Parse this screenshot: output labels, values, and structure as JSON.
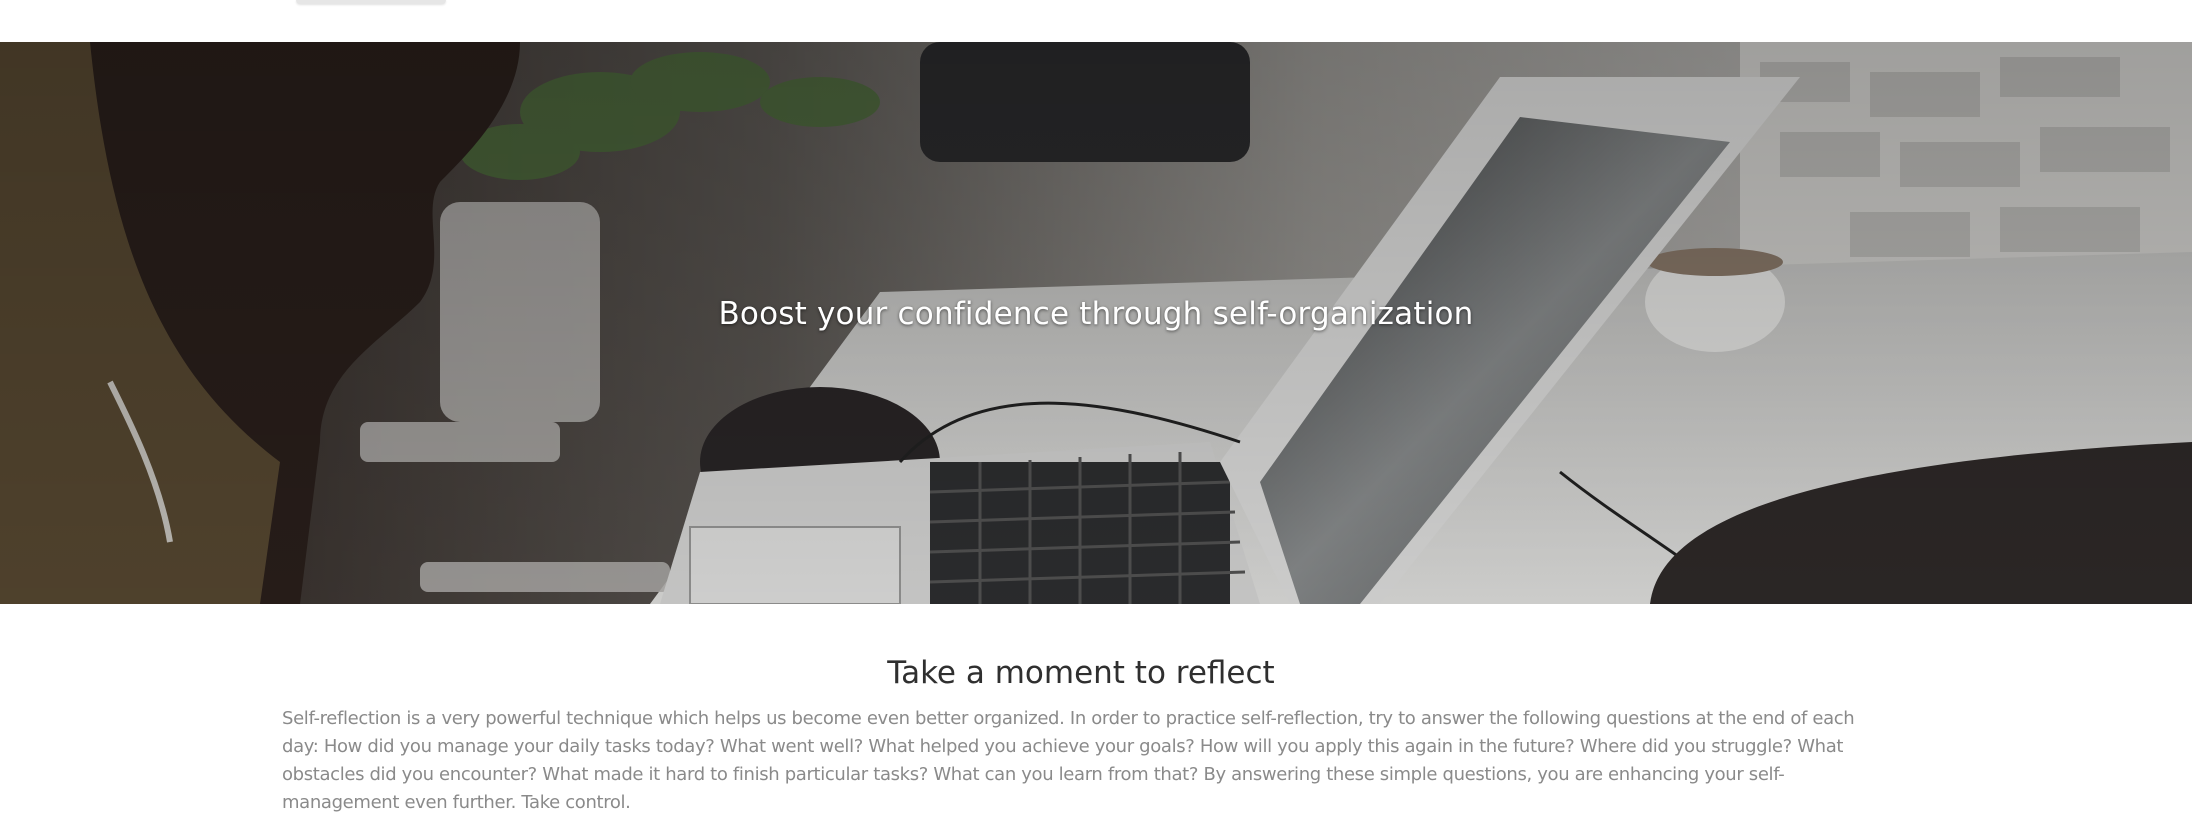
{
  "hero": {
    "title": "Boost your confidence through self-organization"
  },
  "reflect": {
    "heading": "Take a moment to reflect",
    "body": "Self-reflection is a very powerful technique which helps us become even better organized. In order to practice self-reflection, try to answer the following questions at the end of each day: How did you manage your daily tasks today? What went well? What helped you achieve your goals? How will you apply this again in the future? Where did you struggle? What obstacles did you encounter? What made it hard to finish particular tasks? What can you learn from that? By answering these simple questions, you are enhancing your self-management even further. Take control."
  },
  "colors": {
    "hero_overlay": "#2b2624",
    "heading_text": "#2f2f2f",
    "body_text": "#8a8a8a"
  }
}
